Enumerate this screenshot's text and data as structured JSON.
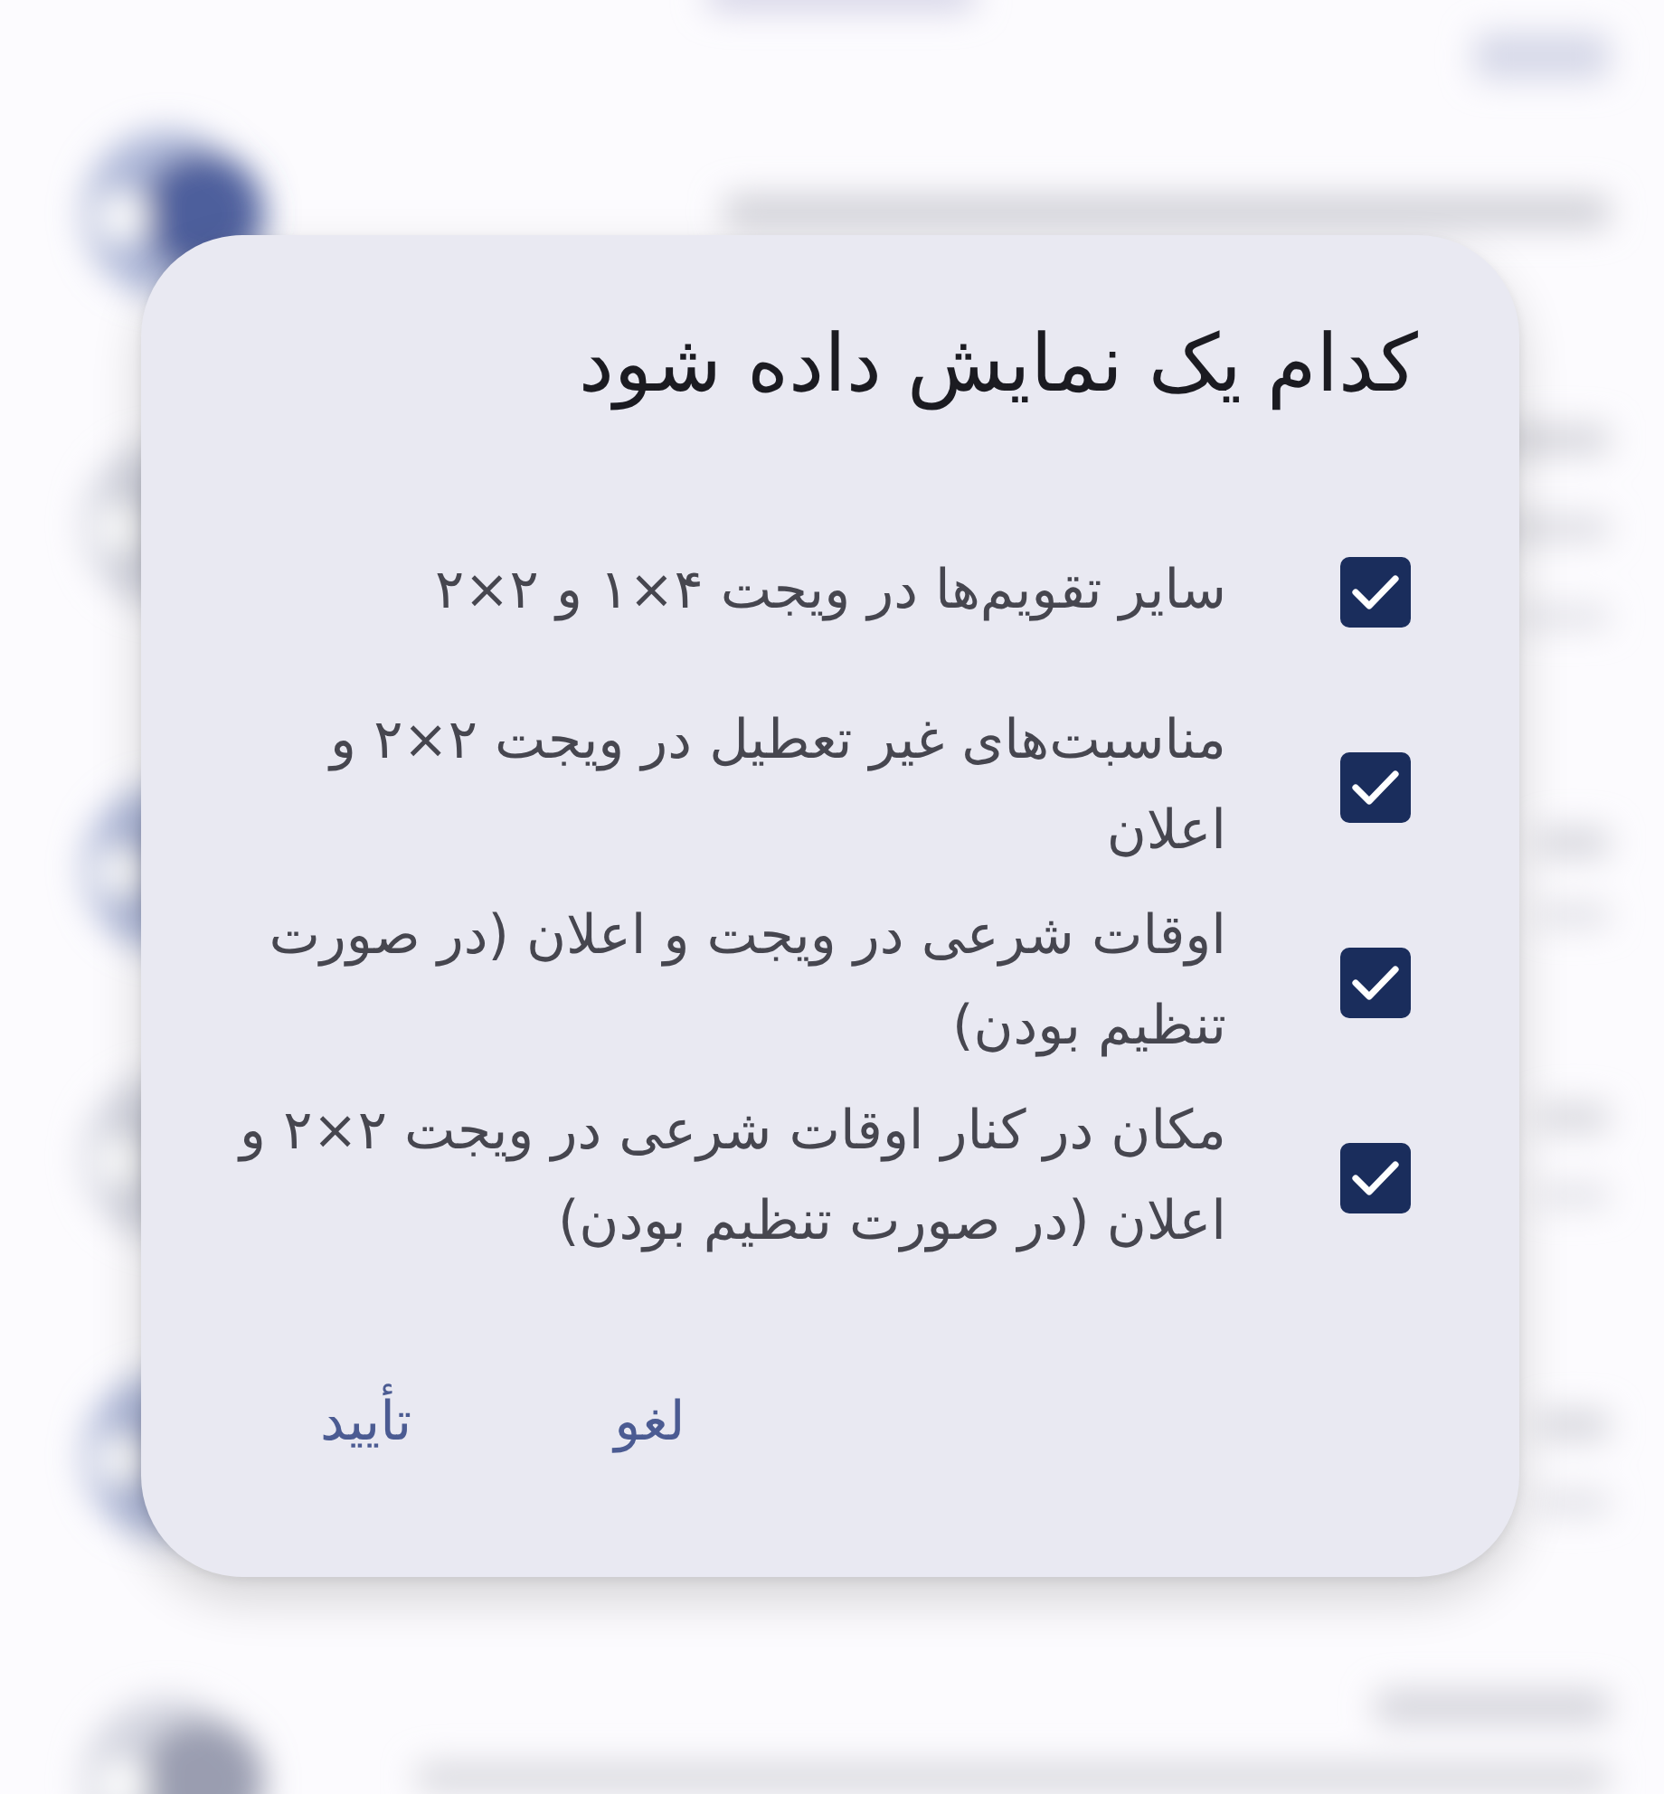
{
  "dialog": {
    "title": "کدام یک نمایش داده شود",
    "options": [
      {
        "label": "سایر تقویم‌ها در ویجت ۴×۱ و ۲×۲",
        "checked": true
      },
      {
        "label": "مناسبت‌های غیر تعطیل در ویجت ۲×۲ و اعلان",
        "checked": true
      },
      {
        "label": "اوقات شرعی در ویجت و اعلان (در صورت تنظیم بودن)",
        "checked": true
      },
      {
        "label": "مکان در کنار اوقات شرعی در ویجت ۲×۲ و اعلان (در صورت تنظیم بودن)",
        "checked": true
      }
    ],
    "buttons": [
      "لغو",
      "تأیید"
    ]
  }
}
